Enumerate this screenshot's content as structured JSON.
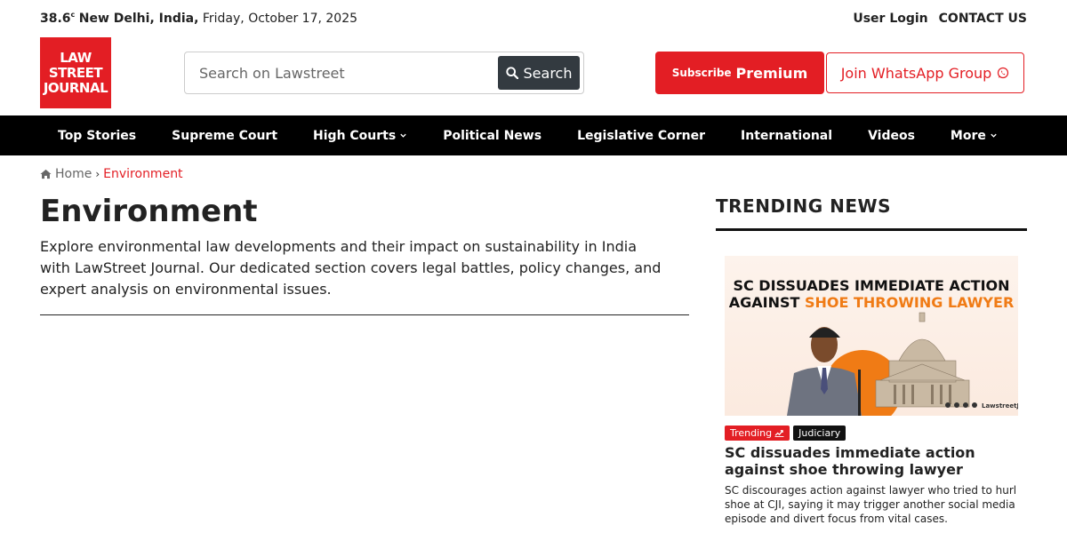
{
  "topbar": {
    "temperature": "38.6",
    "temp_unit": "c",
    "location": "New Delhi, India,",
    "date": "Friday, October 17, 2025",
    "user_login": "User Login",
    "contact": "CONTACT US"
  },
  "logo": {
    "line1": "LAW",
    "line2": "STREET",
    "line3": "JOURNAL"
  },
  "search": {
    "placeholder": "Search on Lawstreet",
    "button_label": "Search"
  },
  "subscribe": {
    "prefix": "Subscribe",
    "label": "Premium"
  },
  "whatsapp": {
    "label": "Join WhatsApp Group"
  },
  "nav": {
    "items": [
      {
        "label": "Top Stories"
      },
      {
        "label": "Supreme Court"
      },
      {
        "label": "High Courts"
      },
      {
        "label": "Political News"
      },
      {
        "label": "Legislative Corner"
      },
      {
        "label": "International"
      },
      {
        "label": "Videos"
      },
      {
        "label": "More"
      }
    ]
  },
  "breadcrumb": {
    "home": "Home",
    "current": "Environment"
  },
  "main": {
    "title": "Environment",
    "description": "Explore environmental law developments and their impact on sustainability in India with LawStreet Journal. Our dedicated section covers legal battles, policy changes, and expert analysis on environmental issues."
  },
  "sidebar": {
    "title": "TRENDING NEWS",
    "story": {
      "image_line1": "SC DISSUADES IMMEDIATE ACTION",
      "image_line2_a": "AGAINST ",
      "image_line2_b": "SHOE THROWING LAWYER",
      "image_handle": "LawstreetJ",
      "tag_trending": "Trending",
      "tag_category": "Judiciary",
      "headline": "SC dissuades immediate action against shoe throwing lawyer",
      "summary": "SC discourages action against lawyer who tried to hurl shoe at CJI, saying it may trigger another social media episode and divert focus from vital cases."
    }
  },
  "colors": {
    "brand_red": "#e31e24",
    "nav_bg": "#000000",
    "accent_orange": "#f07b15"
  }
}
